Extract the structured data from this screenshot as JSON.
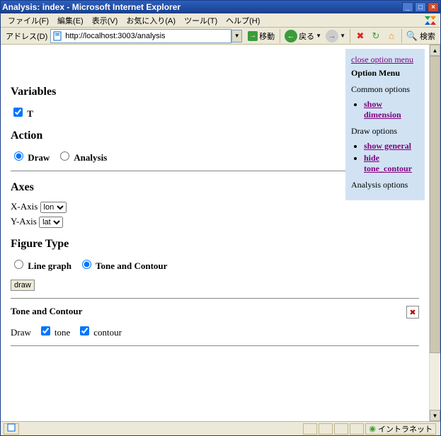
{
  "window": {
    "title": "Analysis: index - Microsoft Internet Explorer",
    "min_label": "_",
    "max_label": "□",
    "close_label": "×"
  },
  "menubar": {
    "file": "ファイル(F)",
    "edit": "編集(E)",
    "view": "表示(V)",
    "favorites": "お気に入り(A)",
    "tools": "ツール(T)",
    "help": "ヘルプ(H)"
  },
  "addressbar": {
    "label": "アドレス(D)",
    "url": "http://localhost:3003/analysis",
    "go": "移動",
    "back": "戻る",
    "search": "検索"
  },
  "page": {
    "variables_heading": "Variables",
    "variable_t": "T",
    "action_heading": "Action",
    "action_draw": "Draw",
    "action_analysis": "Analysis",
    "axes_heading": "Axes",
    "xaxis_label": "X-Axis",
    "yaxis_label": "Y-Axis",
    "xaxis_value": "lon",
    "yaxis_value": "lat",
    "figure_type_heading": "Figure Type",
    "fig_line": "Line graph",
    "fig_tone": "Tone and Contour",
    "draw_button": "draw",
    "tc_heading": "Tone and Contour",
    "tc_draw_label": "Draw",
    "tc_tone": "tone",
    "tc_contour": "contour"
  },
  "option_menu": {
    "close_link": "close option menu",
    "heading": "Option Menu",
    "common_label": "Common options",
    "show_dimension": "show dimension",
    "draw_label": "Draw options",
    "show_general": "show general",
    "hide_tone_contour": "hide tone_contour",
    "analysis_label": "Analysis options"
  },
  "statusbar": {
    "zone": "イントラネット"
  }
}
